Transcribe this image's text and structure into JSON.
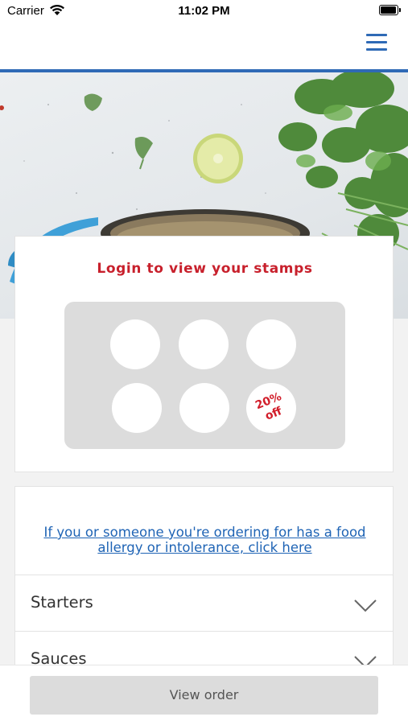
{
  "status_bar": {
    "carrier": "Carrier",
    "time": "11:02 PM"
  },
  "header": {
    "menu_icon": "hamburger-menu-icon",
    "accent_color": "#2f6ab6"
  },
  "hero": {
    "image": "cooking-pot-cilantro-lime-photo"
  },
  "stamps": {
    "title": "Login to view your stamps",
    "title_color": "#c8202c",
    "reward_label": "20% off"
  },
  "menu": {
    "allergy_link": "If you or someone you're ordering for has a food allergy or intolerance, click here",
    "categories": [
      {
        "label": "Starters"
      },
      {
        "label": "Sauces"
      }
    ]
  },
  "bottom": {
    "view_order_label": "View order"
  }
}
